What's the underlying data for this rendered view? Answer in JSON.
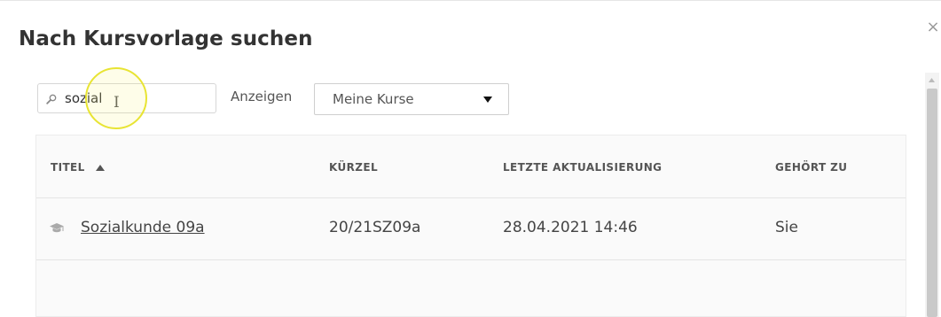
{
  "dialog": {
    "title": "Nach Kursvorlage suchen",
    "close_icon": "×"
  },
  "search": {
    "value": "sozial",
    "icon": "search-icon"
  },
  "filter": {
    "label": "Anzeigen",
    "selected": "Meine Kurse"
  },
  "table": {
    "columns": {
      "title": "TITEL",
      "short": "KÜRZEL",
      "updated": "LETZTE AKTUALISIERUNG",
      "owner": "GEHÖRT ZU"
    },
    "sort": {
      "column": "TITEL",
      "direction": "ascending"
    },
    "rows": [
      {
        "icon": "graduation-cap-icon",
        "title": "Sozialkunde 09a",
        "short": "20/21SZ09a",
        "updated": "28.04.2021 14:46",
        "owner": "Sie"
      }
    ]
  },
  "colors": {
    "highlight_ring": "#e8e433",
    "table_background": "#fafafa",
    "scroll_thumb": "#c9c9c9"
  }
}
